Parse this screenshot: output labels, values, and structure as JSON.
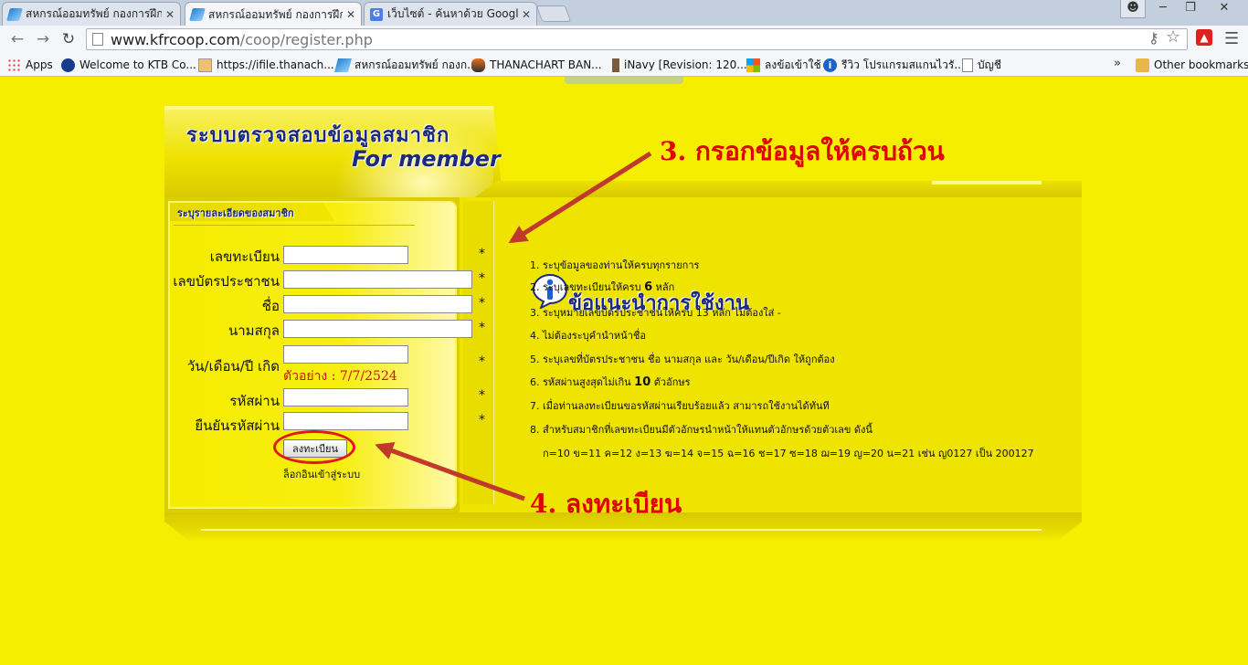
{
  "browser": {
    "tabs": [
      {
        "title": "สหกรณ์ออมทรัพย์ กองการฝึก",
        "active": false,
        "favicon": "kfc-icon"
      },
      {
        "title": "สหกรณ์ออมทรัพย์ กองการฝึก",
        "active": true,
        "favicon": "kfc-icon"
      },
      {
        "title": "เว็บไซต์ - ค้นหาด้วย Google",
        "active": false,
        "favicon": "google-icon"
      }
    ],
    "tab_close": "✕",
    "url_host": "www.kfrcoop.com",
    "url_path": "/coop/register.php",
    "bookmarks": [
      {
        "label": "Apps",
        "icon": "apps-icon"
      },
      {
        "label": "Welcome to KTB Co...",
        "icon": "ktb-icon"
      },
      {
        "label": "https://ifile.thanach...",
        "icon": "ifile-icon"
      },
      {
        "label": "สหกรณ์ออมทรัพย์ กองก...",
        "icon": "kfc-icon"
      },
      {
        "label": "THANACHART BAN...",
        "icon": "thanachart-icon"
      },
      {
        "label": "iNavy [Revision: 120...",
        "icon": "inavy-icon"
      },
      {
        "label": "ลงข้อเข้าใช้",
        "icon": "windows-icon"
      },
      {
        "label": "รีวิว โปรแกรมสแกนไวรั...",
        "icon": "info-icon"
      },
      {
        "label": "บัญชี",
        "icon": "page-icon"
      }
    ],
    "bookmarks_more": "»",
    "other_bookmarks": "Other bookmarks"
  },
  "header": {
    "title": "ระบบตรวจสอบข้อมูลสมาชิก",
    "subtitle": "For member"
  },
  "form": {
    "panel_title": "ระบุรายละเอียดของสมาชิก",
    "fields": [
      {
        "label": "เลขทะเบียน",
        "value": "",
        "required": "*"
      },
      {
        "label": "เลขบัตรประชาชน",
        "value": "",
        "required": "*"
      },
      {
        "label": "ชื่อ",
        "value": "",
        "required": "*"
      },
      {
        "label": "นามสกุล",
        "value": "",
        "required": "*"
      },
      {
        "label": "วัน/เดือน/ปี เกิด",
        "value": "",
        "required": "*"
      },
      {
        "label": "รหัสผ่าน",
        "value": "",
        "required": "*"
      },
      {
        "label": "ยืนยันรหัสผ่าน",
        "value": "",
        "required": "*"
      }
    ],
    "date_example": "ตัวอย่าง : 7/7/2524",
    "submit_label": "ลงทะเบียน",
    "login_link": "ล็อกอินเข้าสู่ระบบ"
  },
  "tips": {
    "heading": "ข้อแนะนำการใช้งาน",
    "items": [
      {
        "text": "1. ระบุข้อมูลของท่านให้ครบทุกรายการ"
      },
      {
        "text": "2. ระบุเลขทะเบียนให้ครบ",
        "bold": "6",
        "after": "หลัก"
      },
      {
        "text": "3. ระบุหมายเลขบัตรประชาชนให้ครบ 13 หลัก ไม่ต้องใส่ -"
      },
      {
        "text": "4. ไม่ต้องระบุคำนำหน้าชื่อ"
      },
      {
        "text": "5. ระบุเลขที่บัตรประชาชน ชื่อ นามสกุล และ วัน/เดือน/ปีเกิด ให้ถูกต้อง"
      },
      {
        "text": "6. รหัสผ่านสูงสุดไม่เกิน",
        "bold": "10",
        "after": "ตัวอักษร"
      },
      {
        "text": "7. เมื่อท่านลงทะเบียนขอรหัสผ่านเรียบร้อยแล้ว สามารถใช้งานได้ทันที"
      },
      {
        "text": "8. สำหรับสมาชิกที่เลขทะเบียนมีตัวอักษรนำหน้าให้แทนตัวอักษรด้วยตัวเลข ดังนี้"
      },
      {
        "text": "ก=10 ข=11 ค=12 ง=13 ฆ=14 จ=15 ฉ=16 ช=17 ซ=18 ฌ=19 ญ=20 น=21 เช่น ญ0127 เป็น 200127"
      }
    ]
  },
  "annotations": {
    "step3": "3. กรอกข้อมูลให้ครบถ้วน",
    "step4": "4. ลงทะเบียน"
  },
  "colors": {
    "page_bg": "#f5ee00",
    "heading_blue": "#1b2a7a",
    "annotation_red": "#e00000",
    "arrow": "#c0392b"
  }
}
